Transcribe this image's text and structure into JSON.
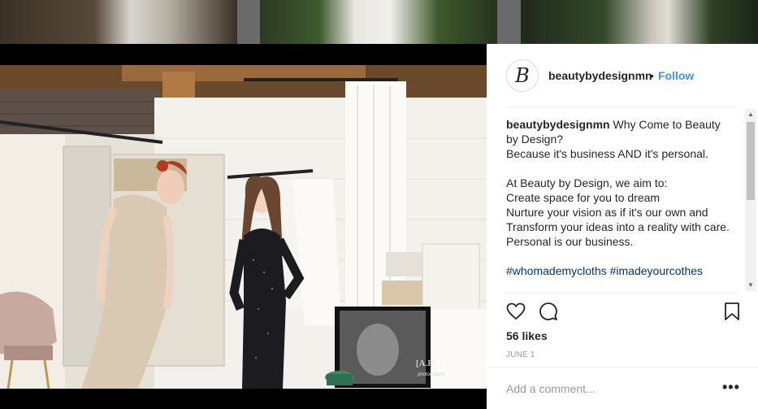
{
  "post": {
    "username": "beautybydesignmn",
    "follow_label": "Follow",
    "separator": "•",
    "avatar_letter": "B",
    "caption_lines": [
      "Why Come to Beauty by Design?",
      "Because it's business AND it's personal."
    ],
    "caption_intro": "At Beauty by Design, we aim to:",
    "caption_aims": [
      "Create space for you to dream",
      "Nurture your vision as if it's our own and Transform your ideas into a reality with care.",
      "Personal is our business."
    ],
    "hashtags": "#whomademycloths #imadeyourcothes",
    "likes": "56 likes",
    "date": "JUNE 1",
    "comment_placeholder": "Add a comment...",
    "more_label": "•••",
    "photo_watermark": "[A.R.T]",
    "photo_watermark_sub": "photography"
  },
  "colors": {
    "accent": "#3897f0",
    "hashtag": "#003569",
    "text": "#262626",
    "muted": "#999999"
  }
}
